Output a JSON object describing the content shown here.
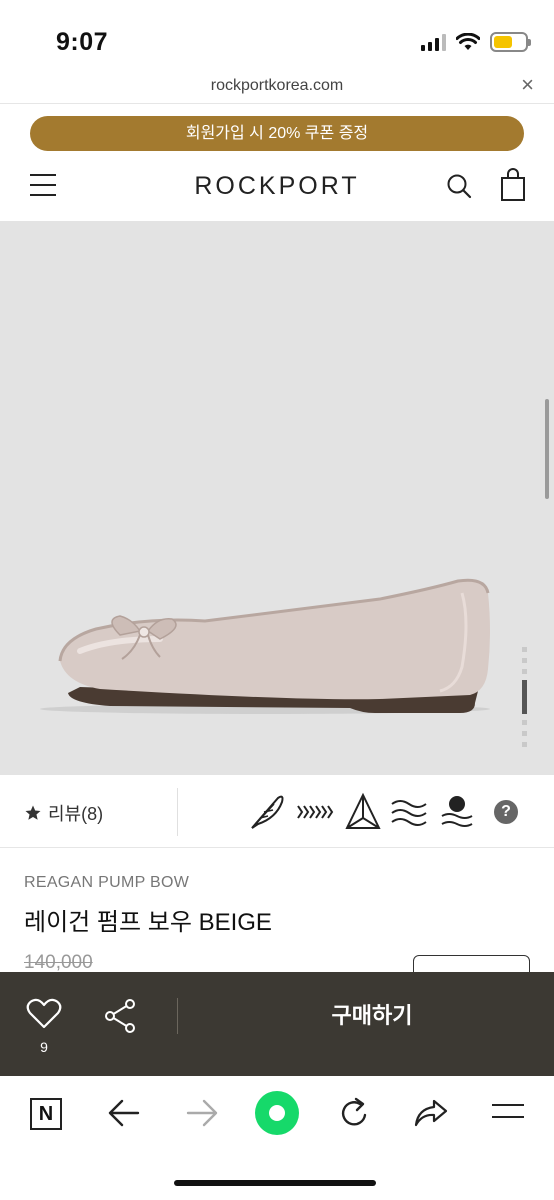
{
  "status_bar": {
    "time": "9:07",
    "battery_level": 0.6,
    "battery_color": "#f5c400"
  },
  "browser": {
    "url": "rockportkorea.com",
    "close_label": "×"
  },
  "promo": {
    "text": "회원가입 시 20% 쿠폰 증정",
    "color": "#a37a2f"
  },
  "header": {
    "logo": "ROCKPORT"
  },
  "gallery": {
    "page_count": 7,
    "active_index": 3
  },
  "features": {
    "review_label": "리뷰(8)",
    "icons": [
      "feather-icon",
      "arrows-icon",
      "pyramid-icon",
      "waves-icon",
      "water-drop-icon",
      "help-icon"
    ],
    "help_label": "?"
  },
  "product": {
    "sub_name": "REAGAN PUMP BOW",
    "name": "레이건 펌프 보우 BEIGE",
    "original_price": "140,000"
  },
  "buy_bar": {
    "like_count": "9",
    "buy_label": "구매하기",
    "bg_color": "#3c3933"
  },
  "toolbar": {
    "n_label": "N",
    "accent_color": "#16d96a"
  }
}
